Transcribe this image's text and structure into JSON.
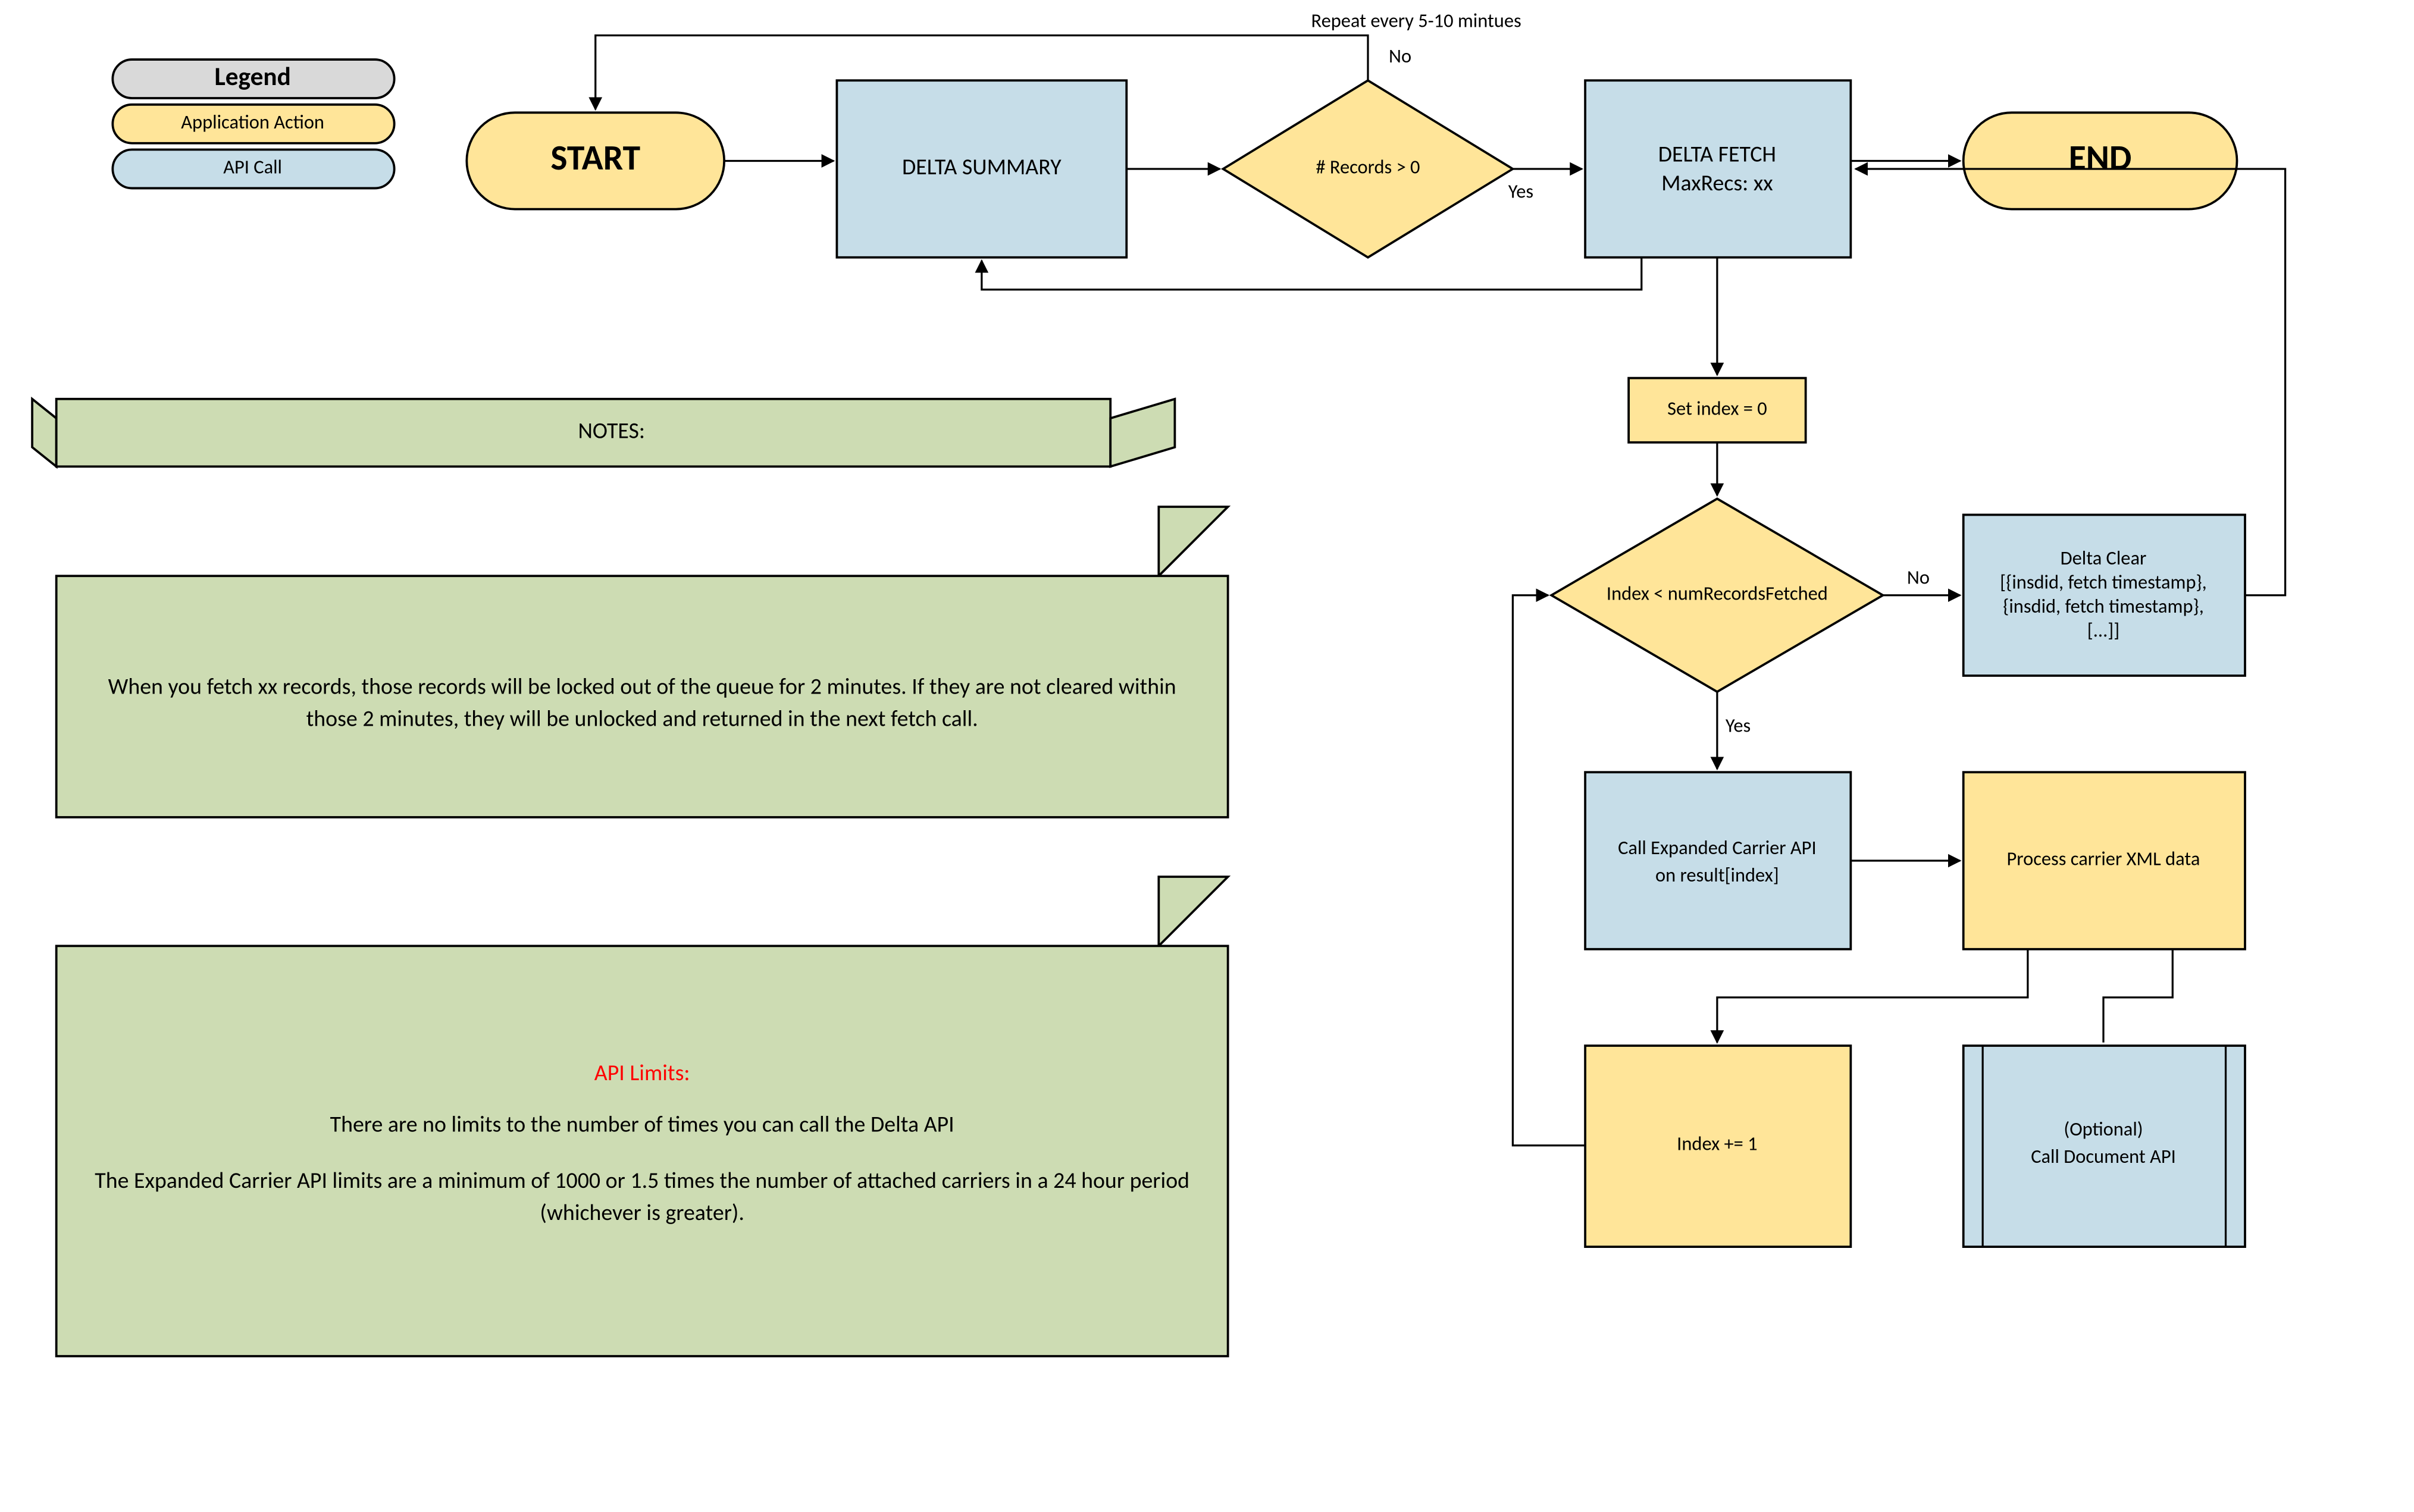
{
  "legend": {
    "title": "Legend",
    "app_action": "Application Action",
    "api_call": "API Call"
  },
  "nodes": {
    "start": "START",
    "delta_summary": "DELTA SUMMARY",
    "records_decision": "# Records > 0",
    "delta_fetch_l1": "DELTA FETCH",
    "delta_fetch_l2": "MaxRecs: xx",
    "end": "END",
    "set_index": "Set index = 0",
    "index_decision": "Index < numRecordsFetched",
    "delta_clear_l1": "Delta Clear",
    "delta_clear_l2": "[{insdid, fetch timestamp},",
    "delta_clear_l3": "{insdid, fetch timestamp},",
    "delta_clear_l4": "[...]]",
    "call_exp_l1": "Call Expanded Carrier API",
    "call_exp_l2": "on result[index]",
    "process_xml": "Process carrier XML data",
    "index_inc": "Index += 1",
    "call_doc_l1": "(Optional)",
    "call_doc_l2": "Call Document API"
  },
  "edges": {
    "repeat": "Repeat every 5-10 mintues",
    "no": "No",
    "yes": "Yes",
    "yes2": "Yes",
    "no2": "No"
  },
  "notes": {
    "banner": "NOTES:",
    "note1_l1": "When you fetch xx records, those records will be locked out of the queue for 2 minutes.  If they are not cleared within",
    "note1_l2": "those 2 minutes, they will be unlocked and returned in the next fetch call.",
    "note2_title": "API Limits:",
    "note2_l1": "There are no limits to the number of times you can call the Delta API",
    "note2_l2": "The Expanded Carrier API limits are a minimum of 1000 or 1.5 times the number of attached carriers in a 24 hour period",
    "note2_l3": "(whichever is greater)."
  }
}
